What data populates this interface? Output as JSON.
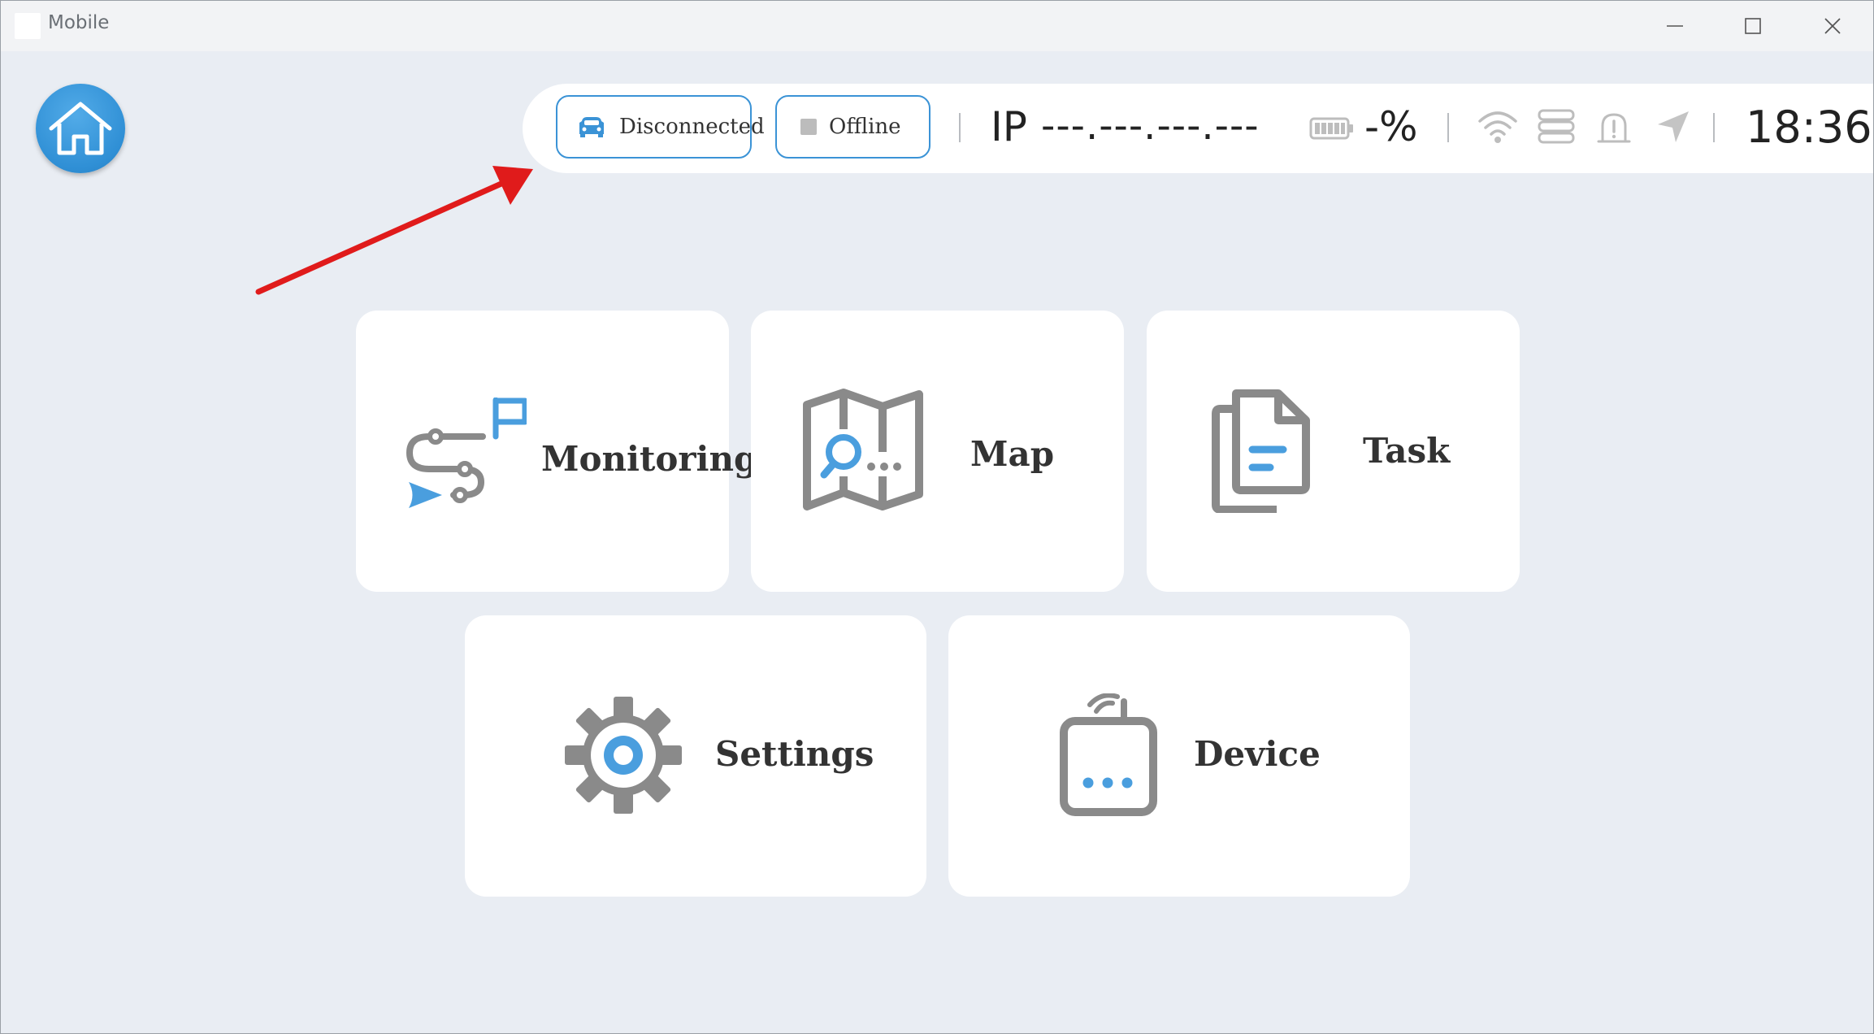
{
  "window": {
    "title": "Mobile"
  },
  "status": {
    "connection_label": "Disconnected",
    "mode_label": "Offline",
    "ip_label": "IP",
    "ip_value": "---.---.---.---",
    "battery_pct": "-%",
    "time": "18:36"
  },
  "menu": {
    "monitoring": "Monitoring",
    "map": "Map",
    "task": "Task",
    "settings": "Settings",
    "device": "Device"
  },
  "colors": {
    "accent": "#3b93d6",
    "icon_gray": "#8a8a8a",
    "icon_blue": "#4a9ede",
    "background": "#e9edf3",
    "annotation": "#e01b1b"
  },
  "icons": {
    "home": "home-icon",
    "connection": "vehicle-icon",
    "offline": "stop-square-icon",
    "battery": "battery-icon",
    "wifi": "wifi-icon",
    "storage": "storage-icon",
    "alarm": "alarm-icon",
    "navigation": "navigation-icon"
  }
}
